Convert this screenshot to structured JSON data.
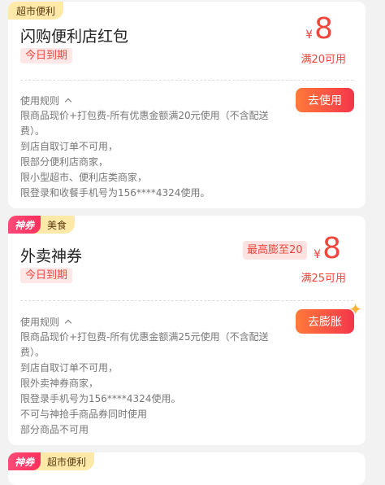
{
  "coupons": [
    {
      "tag": "超市便利",
      "title": "闪购便利店红包",
      "expire": "今日到期",
      "currency": "¥",
      "amount": "8",
      "condition": "满20可用",
      "rules_label": "使用规则",
      "button": "去使用",
      "rules": [
        "限商品现价+打包费-所有优惠金额满20元使用（不含配送费）。",
        "到店自取订单不可用，",
        "限部分便利店商家，",
        "限小型超市、便利店类商家，",
        "限登录和收餐手机号为156****4324使用。"
      ]
    },
    {
      "tag_badge": "神券",
      "tag": "美食",
      "title": "外卖神券",
      "expire": "今日到期",
      "boost": "最高膨至20",
      "currency": "¥",
      "amount": "8",
      "condition": "满25可用",
      "rules_label": "使用规则",
      "button": "去膨胀",
      "rules": [
        "限商品现价+打包费-所有优惠金额满25元使用（不含配送费）。",
        "到店自取订单不可用，",
        "限外卖神券商家，",
        "限登录手机号为156****4324使用。",
        "不可与神抢手商品券同时使用",
        "部分商品不可用"
      ]
    },
    {
      "tag_badge": "神券",
      "tag": "超市便利"
    }
  ]
}
